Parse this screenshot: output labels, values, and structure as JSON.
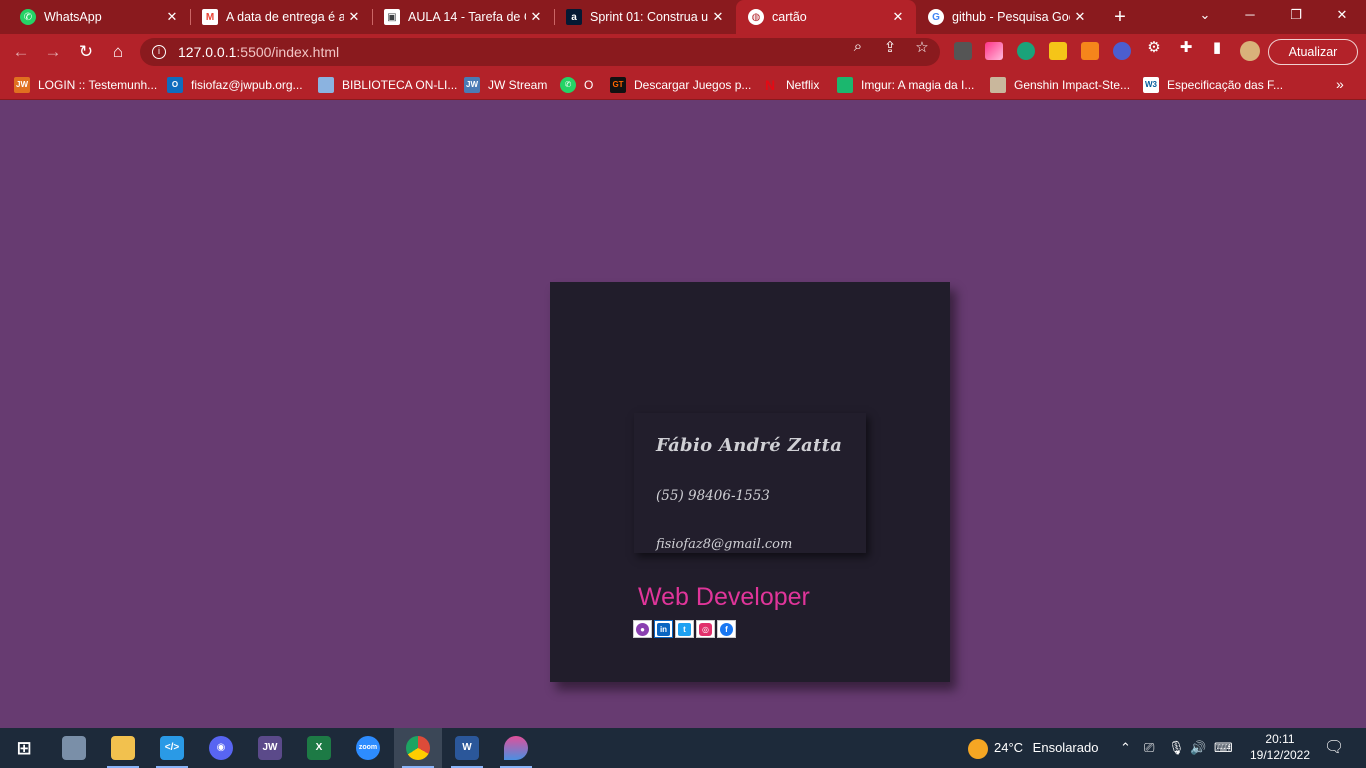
{
  "browser": {
    "tabs": [
      {
        "title": "WhatsApp",
        "icon": "whatsapp-icon",
        "color": "#25d366"
      },
      {
        "title": "A data de entrega é a",
        "icon": "gmail-icon",
        "color": "#ea4335"
      },
      {
        "title": "AULA 14 - Tarefa de C",
        "icon": "classroom-icon",
        "color": "#3c4043"
      },
      {
        "title": "Sprint 01: Construa u",
        "icon": "alura-icon",
        "color": "#051933"
      },
      {
        "title": "cartão",
        "icon": "globe-icon",
        "color": "#b32229"
      },
      {
        "title": "github - Pesquisa Goo",
        "icon": "google-icon",
        "color": "#ffffff"
      }
    ],
    "new_tab_label": "+",
    "address": {
      "host": "127.0.0.1",
      "path": ":5500/index.html"
    },
    "update_label": "Atualizar",
    "bookmarks": [
      {
        "label": "LOGIN :: Testemunh...",
        "icon": "jw-icon",
        "color": "#e07020"
      },
      {
        "label": "fisiofaz@jwpub.org...",
        "icon": "outlook-icon",
        "color": "#0f6cbd"
      },
      {
        "label": "BIBLIOTECA ON-LI...",
        "icon": "library-icon",
        "color": "#8bb3e0"
      },
      {
        "label": "JW Stream",
        "icon": "jw-stream-icon",
        "color": "#4a7bb5"
      },
      {
        "label": "O",
        "icon": "whatsapp-icon",
        "color": "#25d366"
      },
      {
        "label": "Descargar Juegos p...",
        "icon": "games-icon",
        "color": "#111111"
      },
      {
        "label": "Netflix",
        "icon": "netflix-icon",
        "color": "#e50914"
      },
      {
        "label": "Imgur: A magia da I...",
        "icon": "imgur-icon",
        "color": "#1bb76e"
      },
      {
        "label": "Genshin Impact-Ste...",
        "icon": "genshin-icon",
        "color": "#c9b79c"
      },
      {
        "label": "Especificação das F...",
        "icon": "w3c-icon",
        "color": "#ffffff"
      }
    ]
  },
  "card": {
    "name": "Fábio André Zatta",
    "phone": "(55) 98406-1553",
    "email": "fisiofaz8@gmail.com",
    "role": "Web Developer",
    "socials": [
      {
        "name": "github-icon",
        "color": "#8a3fb0"
      },
      {
        "name": "linkedin-icon",
        "color": "#0a66c2"
      },
      {
        "name": "twitter-icon",
        "color": "#1da1f2"
      },
      {
        "name": "instagram-icon",
        "color": "#e1306c"
      },
      {
        "name": "facebook-icon",
        "color": "#1877f2"
      }
    ]
  },
  "taskbar": {
    "apps": [
      {
        "name": "windows-start-icon",
        "color": "#ffffff"
      },
      {
        "name": "photos-icon",
        "color": "#7a8fa8"
      },
      {
        "name": "file-explorer-icon",
        "color": "#f2c14e"
      },
      {
        "name": "vscode-icon",
        "color": "#2a9ae6"
      },
      {
        "name": "discord-icon",
        "color": "#5865f2"
      },
      {
        "name": "jw-library-icon",
        "color": "#5b4a8a"
      },
      {
        "name": "excel-icon",
        "color": "#1d7a45"
      },
      {
        "name": "zoom-icon",
        "color": "#2d8cff"
      },
      {
        "name": "chrome-icon",
        "color": "#dd4b39"
      },
      {
        "name": "word-icon",
        "color": "#2b579a"
      },
      {
        "name": "paint-icon",
        "color": "#e0509a"
      }
    ],
    "weather": {
      "temp": "24°C",
      "condition": "Ensolarado"
    },
    "time": "20:11",
    "date": "19/12/2022"
  },
  "colors": {
    "page_bg": "#673b71",
    "card_bg": "#211d2b",
    "accent": "#e0359a",
    "browser_red": "#b32229"
  }
}
